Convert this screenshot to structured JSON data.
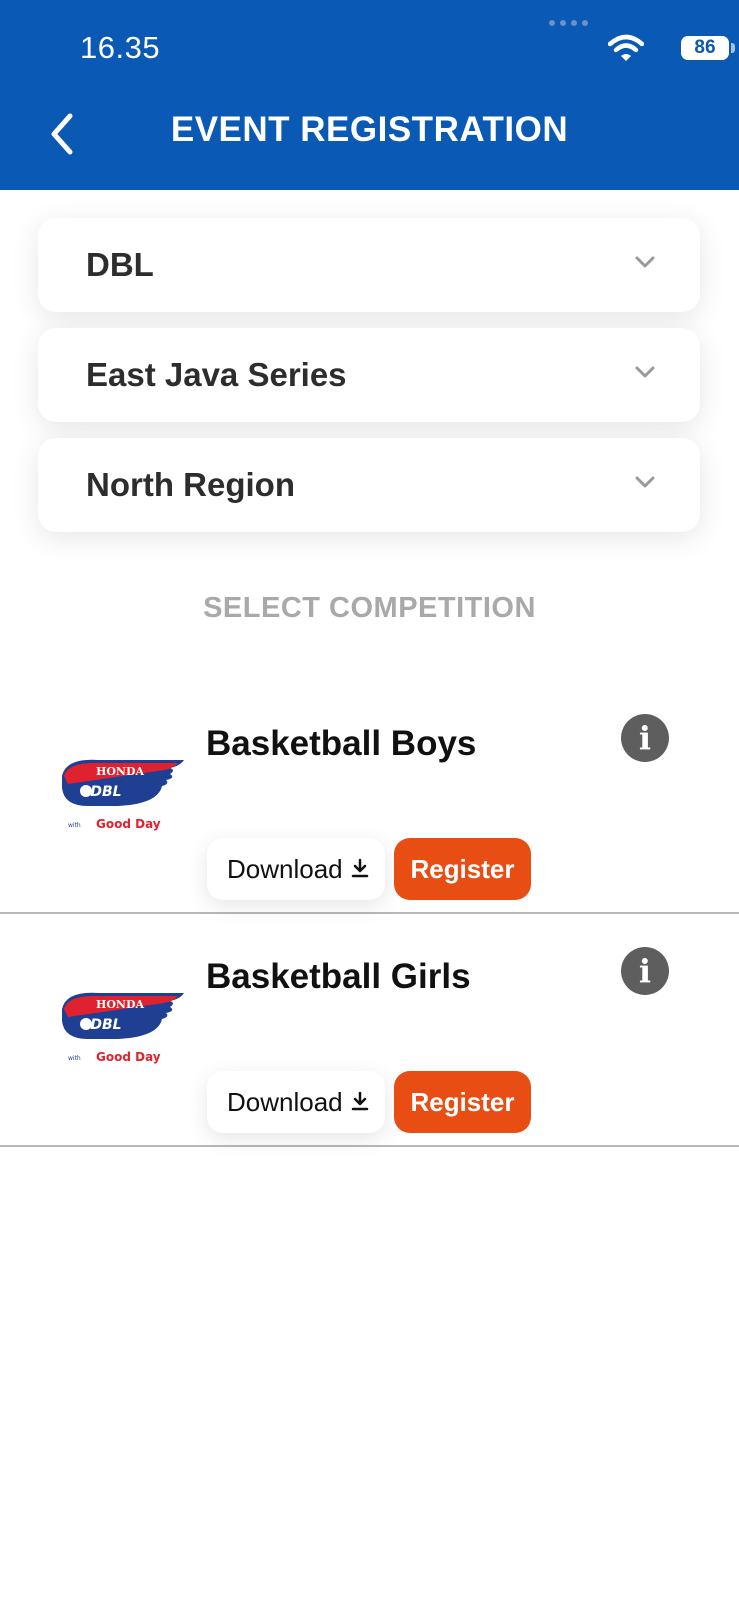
{
  "status_bar": {
    "time": "16.35",
    "battery": "86"
  },
  "header": {
    "title": "EVENT REGISTRATION"
  },
  "filters": [
    {
      "value": "DBL"
    },
    {
      "value": "East Java Series"
    },
    {
      "value": "North Region"
    }
  ],
  "section_title": "SELECT COMPETITION",
  "logo_text": {
    "brand": "HONDA",
    "league": "DBL",
    "with": "with",
    "sponsor": "Good Day"
  },
  "competitions": [
    {
      "name": "Basketball Boys",
      "download_label": "Download",
      "register_label": "Register"
    },
    {
      "name": "Basketball Girls",
      "download_label": "Download",
      "register_label": "Register"
    }
  ],
  "colors": {
    "header_bg": "#0a59b4",
    "register_bg": "#e84d13",
    "info_bg": "#5e5e5e"
  }
}
